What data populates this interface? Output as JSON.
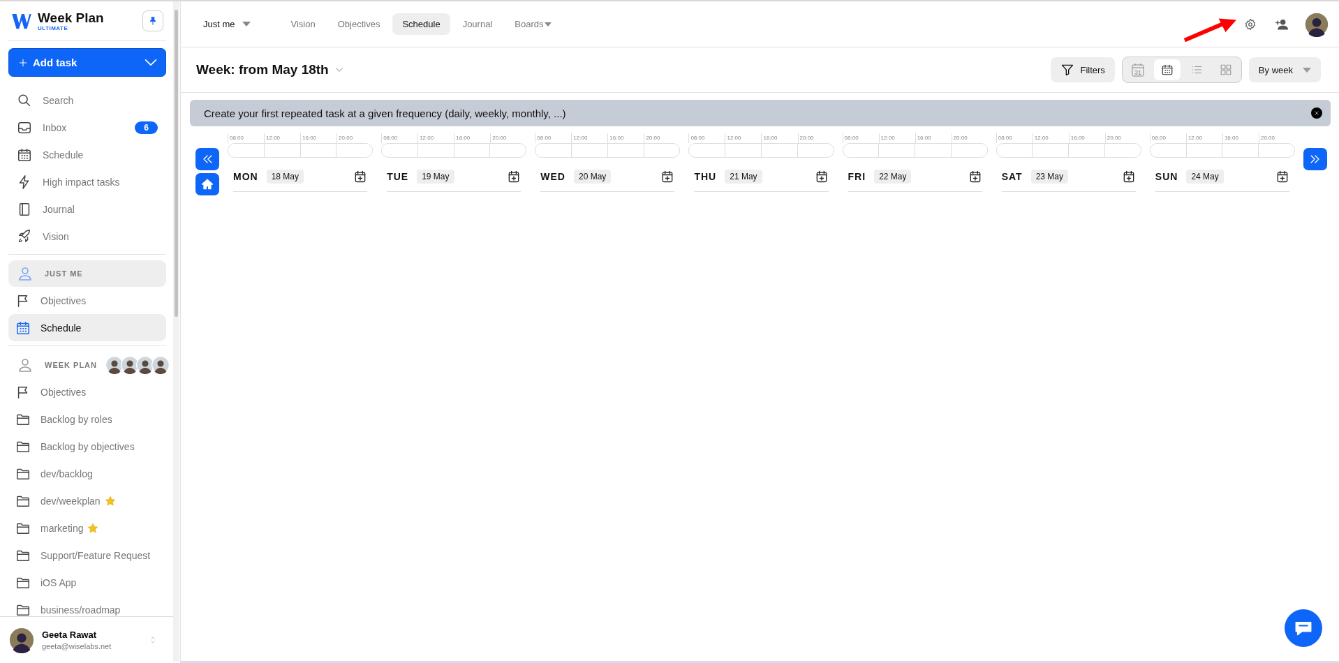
{
  "sidebar": {
    "app_name": "Week Plan",
    "edition": "ULTIMATE",
    "add_task": "Add task",
    "nav": [
      {
        "label": "Search",
        "kind": "search"
      },
      {
        "label": "Inbox",
        "kind": "inbox",
        "badge": "6"
      },
      {
        "label": "Schedule",
        "kind": "calendar"
      },
      {
        "label": "High impact tasks",
        "kind": "bolt"
      },
      {
        "label": "Journal",
        "kind": "journal"
      },
      {
        "label": "Vision",
        "kind": "rocket"
      }
    ],
    "sections": [
      {
        "title": "JUST ME",
        "selected": true,
        "items": [
          {
            "label": "Objectives",
            "kind": "flag",
            "selected": false,
            "starred": false
          },
          {
            "label": "Schedule",
            "kind": "calendar",
            "selected": true,
            "starred": false
          }
        ]
      },
      {
        "title": "WEEK PLAN",
        "selected": false,
        "members": [
          {
            "kind": "avatar"
          },
          {
            "kind": "avatar"
          },
          {
            "kind": "avatar"
          },
          {
            "kind": "avatar"
          }
        ],
        "items": [
          {
            "label": "Objectives",
            "kind": "flag",
            "selected": false,
            "starred": false
          },
          {
            "label": "Backlog by roles",
            "kind": "folder",
            "selected": false,
            "starred": false
          },
          {
            "label": "Backlog by objectives",
            "kind": "folder",
            "selected": false,
            "starred": false
          },
          {
            "label": "dev/backlog",
            "kind": "folder",
            "selected": false,
            "starred": false
          },
          {
            "label": "dev/weekplan",
            "kind": "folder",
            "selected": false,
            "starred": true
          },
          {
            "label": "marketing",
            "kind": "folder",
            "selected": false,
            "starred": true
          },
          {
            "label": "Support/Feature Request",
            "kind": "folder",
            "selected": false,
            "starred": false
          },
          {
            "label": "iOS App",
            "kind": "folder",
            "selected": false,
            "starred": false
          },
          {
            "label": "business/roadmap",
            "kind": "folder",
            "selected": false,
            "starred": false
          }
        ]
      }
    ],
    "user": {
      "name": "Geeta Rawat",
      "email": "geeta@wiselabs.net"
    }
  },
  "topbar": {
    "scope": "Just me",
    "tabs": [
      {
        "label": "Vision",
        "selected": false,
        "dropdown": false
      },
      {
        "label": "Objectives",
        "selected": false,
        "dropdown": false
      },
      {
        "label": "Schedule",
        "selected": true,
        "dropdown": false
      },
      {
        "label": "Journal",
        "selected": false,
        "dropdown": false
      },
      {
        "label": "Boards",
        "selected": false,
        "dropdown": true
      }
    ]
  },
  "toolbar": {
    "title": "Week: from May 18th",
    "filters": "Filters",
    "views": [
      {
        "kind": "month",
        "label": "31",
        "selected": false
      },
      {
        "kind": "week",
        "selected": true
      },
      {
        "kind": "list",
        "selected": false
      },
      {
        "kind": "grid",
        "selected": false
      }
    ],
    "period": "By week"
  },
  "banner": {
    "text": "Create your first repeated task at a given frequency (daily, weekly, monthly, ...)"
  },
  "days": [
    {
      "day": "MON",
      "date": "18 May",
      "hours": [
        "08:00",
        "12:00",
        "16:00",
        "20:00"
      ]
    },
    {
      "day": "TUE",
      "date": "19 May",
      "hours": [
        "08:00",
        "12:00",
        "16:00",
        "20:00"
      ]
    },
    {
      "day": "WED",
      "date": "20 May",
      "hours": [
        "08:00",
        "12:00",
        "16:00",
        "20:00"
      ]
    },
    {
      "day": "THU",
      "date": "21 May",
      "hours": [
        "08:00",
        "12:00",
        "16:00",
        "20:00"
      ]
    },
    {
      "day": "FRI",
      "date": "22 May",
      "hours": [
        "08:00",
        "12:00",
        "16:00",
        "20:00"
      ]
    },
    {
      "day": "SAT",
      "date": "23 May",
      "hours": [
        "08:00",
        "12:00",
        "16:00",
        "20:00"
      ]
    },
    {
      "day": "SUN",
      "date": "24 May",
      "hours": [
        "08:00",
        "12:00",
        "16:00",
        "20:00"
      ]
    }
  ]
}
